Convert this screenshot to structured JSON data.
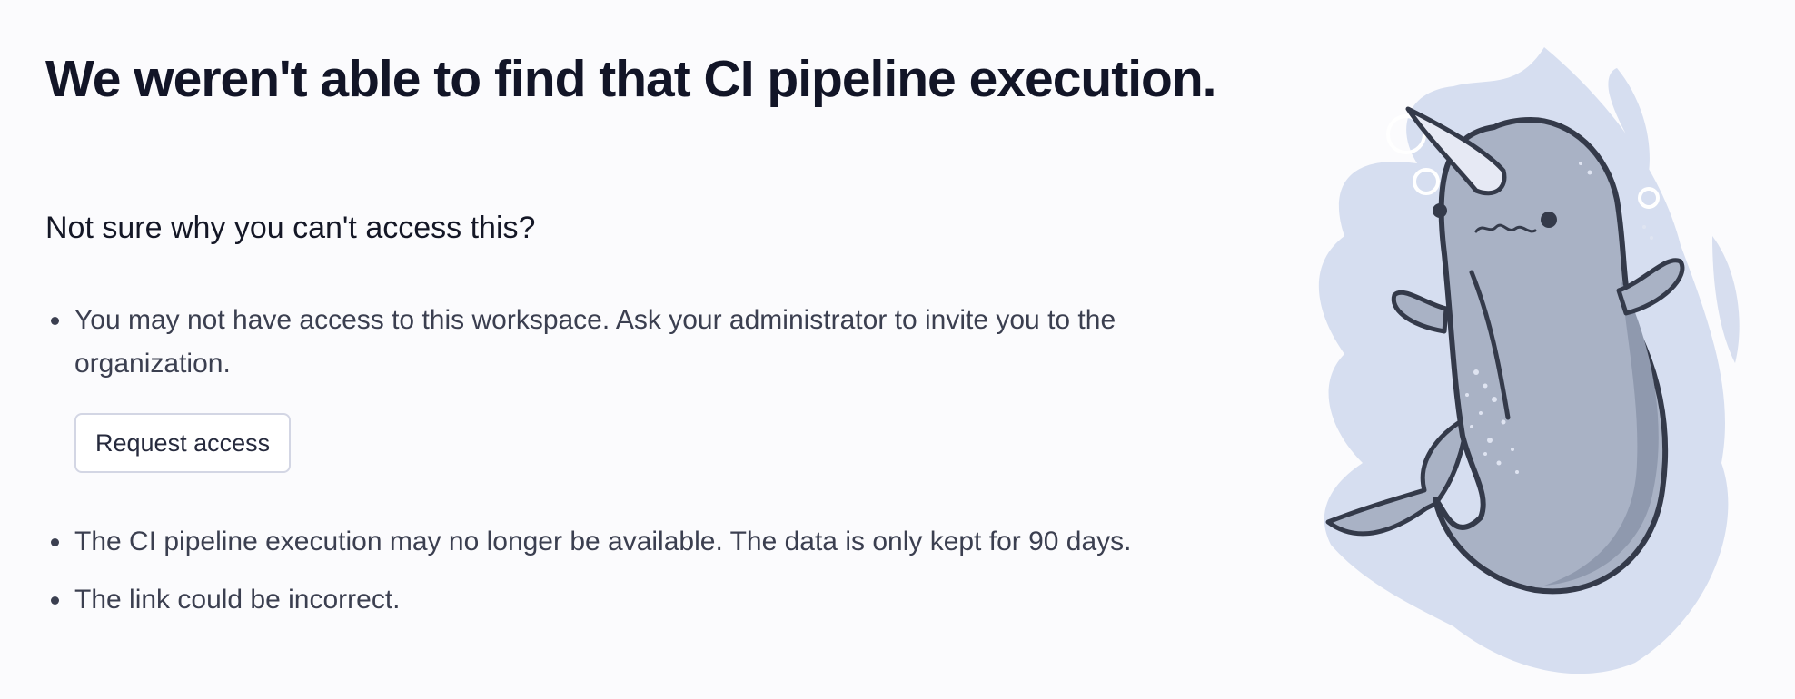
{
  "page": {
    "title": "We weren't able to find that CI pipeline execution.",
    "subheading": "Not sure why you can't access this?"
  },
  "reasons": [
    {
      "text": "You may not have access to this workspace. Ask your administrator to invite you to the organization."
    },
    {
      "text": "The CI pipeline execution may no longer be available. The data is only kept for 90 days."
    },
    {
      "text": "The link could be incorrect."
    }
  ],
  "actions": {
    "request_access_label": "Request access"
  },
  "illustration": {
    "name": "narwhal-illustration",
    "colors": {
      "splash": "#d6def0",
      "body": "#a9b2c5",
      "belly_shadow": "#8f99ae",
      "outline": "#343a4a",
      "horn": "#e6e9f4"
    }
  }
}
